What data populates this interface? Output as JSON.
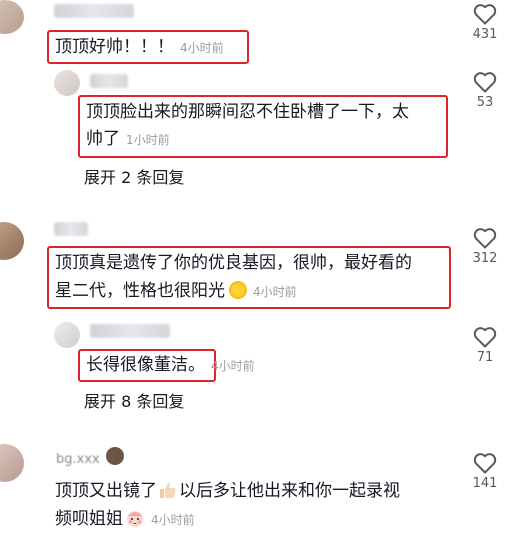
{
  "comments": [
    {
      "text": "顶顶好帅！！！",
      "time": "4小时前",
      "likes": "431"
    },
    {
      "text": "顶顶脸出来的那瞬间忍不住卧槽了一下，太",
      "text2": "帅了",
      "time": "1小时前",
      "likes": "53",
      "expand": "展开 2 条回复"
    },
    {
      "text": "顶顶真是遗传了你的优良基因，很帅，最好看的",
      "text2": "星二代，性格也很阳光",
      "time": "4小时前",
      "likes": "312"
    },
    {
      "text": "长得很像董洁。",
      "time": "4小时前",
      "likes": "71",
      "expand": "展开 8 条回复"
    },
    {
      "username": "bg.xxx",
      "text": "顶顶又出镜了",
      "text_after": "以后多让他出来和你一起录视",
      "text2": "频呗姐姐",
      "time": "4小时前",
      "likes": "141"
    }
  ],
  "icons": {
    "like": "heart-outline-icon",
    "sun": "sun-emoji-icon",
    "thumb": "thumbs-up-emoji-icon",
    "face": "blushing-face-emoji-icon"
  },
  "colors": {
    "highlight": "#e0242b",
    "timestamp": "#9a9ca3"
  }
}
